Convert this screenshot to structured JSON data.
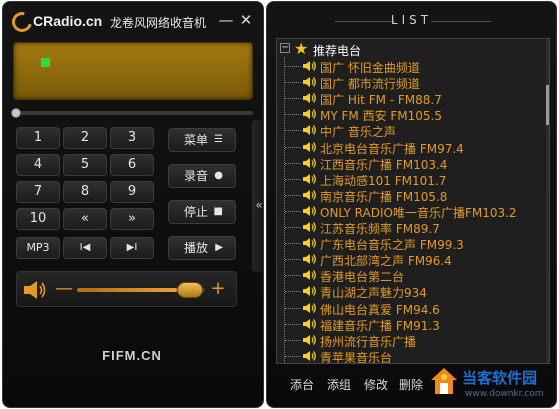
{
  "player": {
    "brand": "CRadio.cn",
    "title": "龙卷风网络收音机",
    "minimize_icon": "minimize-icon",
    "close_icon": "close-icon",
    "minimize_glyph": "—",
    "close_glyph": "✕",
    "accent_color": "#e39a25",
    "display_color": "#8f6a10",
    "indicator_color": "#28e03a",
    "numpad": [
      "1",
      "2",
      "3",
      "4",
      "5",
      "6",
      "7",
      "8",
      "9",
      "10",
      "«",
      "»"
    ],
    "transport": {
      "mp3": "MP3",
      "prev": "I◀",
      "next": "▶I"
    },
    "menu_label": "菜单",
    "record_label": "录音",
    "stop_label": "停止",
    "play_label": "播放",
    "menu_icon_glyph": "☰",
    "record_icon_glyph": "●",
    "stop_icon_glyph": "■",
    "play_icon_glyph": "▶",
    "collapse_glyph": "«",
    "volume_minus": "—",
    "volume_plus": "+",
    "volume_level": 0.78,
    "footer_brand": "FIFM.CN"
  },
  "list": {
    "title": "LIST",
    "expander": "−",
    "root_label": "推荐电台",
    "stations": [
      "国广 怀旧金曲频道",
      "国广 都市流行频道",
      "国广 Hit FM - FM88.7",
      "MY FM 西安 FM105.5",
      "中广 音乐之声",
      "北京电台音乐广播 FM97.4",
      "江西音乐广播 FM103.4",
      "上海动感101 FM101.7",
      "南京音乐广播 FM105.8",
      "ONLY RADIO唯一音乐广播FM103.2",
      "江苏音乐频率 FM89.7",
      "广东电台音乐之声 FM99.3",
      "广西北部湾之声 FM96.4",
      "香港电台第二台",
      "青山湖之声魅力934",
      "佛山电台真爱 FM94.6",
      "福建音乐广播 FM91.3",
      "扬州流行音乐广播",
      "青苹果音乐台"
    ],
    "actions": [
      "添台",
      "添组",
      "修改",
      "删除"
    ]
  },
  "watermark": {
    "brand": "当客软件园",
    "url": "www.downkr.com"
  }
}
